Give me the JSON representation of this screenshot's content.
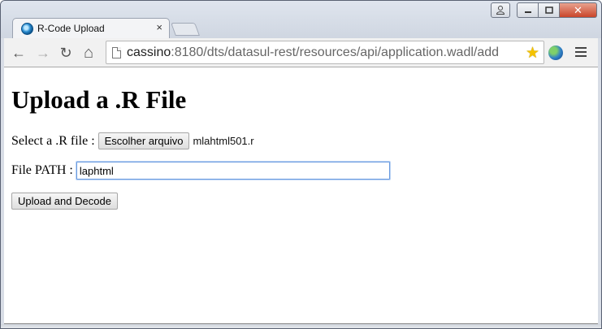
{
  "browser": {
    "tab": {
      "title": "R-Code Upload",
      "close_symbol": "×",
      "favicon": "chrome-globe-icon"
    },
    "window_controls": {
      "user_symbol": "👤",
      "minimize_symbol": "▭",
      "maximize_symbol": "□",
      "close_symbol": "✕"
    },
    "toolbar": {
      "back_symbol": "←",
      "forward_symbol": "→",
      "reload_symbol": "↻",
      "home_symbol": "⌂",
      "star_symbol": "★",
      "url_host": "cassino",
      "url_rest": ":8180/dts/datasul-rest/resources/api/application.wadl/add"
    }
  },
  "page": {
    "title": "Upload a .R File",
    "file_label": "Select a .R file : ",
    "file_button_label": "Escolher arquivo",
    "file_name": "mlahtml501.r",
    "path_label": "File PATH : ",
    "path_value": "laphtml",
    "submit_label": "Upload and Decode"
  },
  "colors": {
    "input_focus": "#6a9be0",
    "star": "#f4c200",
    "close_button": "#c9452a"
  }
}
